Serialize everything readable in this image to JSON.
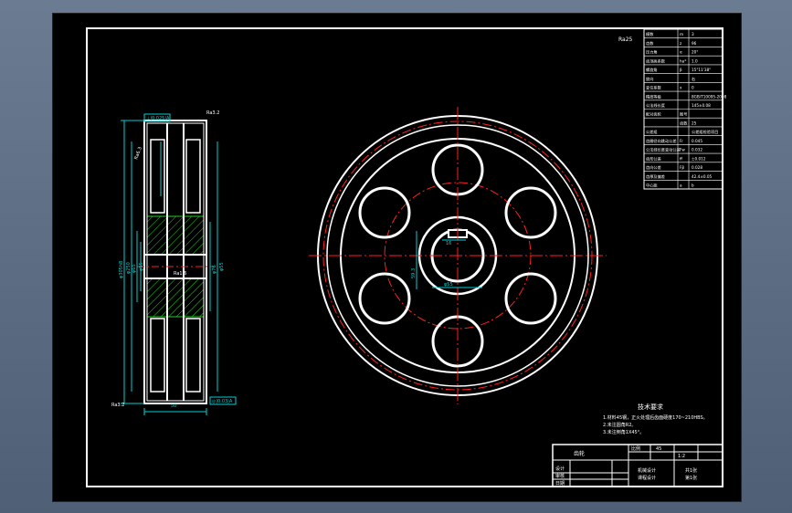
{
  "colors": {
    "background": "#000000",
    "frame": "#ffffff",
    "dimension": "#00d0d0",
    "centerline": "#ff2020",
    "hatch": "#1ed21e",
    "annotation": "#ffffff"
  },
  "side_view": {
    "callouts": [
      "Ra3.2",
      "Ra6.3",
      "Ra1.6",
      "Ra3.2"
    ],
    "datum_box": "⊥|0.025|A",
    "datum_box_bottom": "◎|0.03|A",
    "dims_left": [
      "φ305h8",
      "φ250",
      "φ65",
      "φ55"
    ],
    "dims_right": [
      "φ76",
      "φ55"
    ],
    "width_dim": "50"
  },
  "front_view": {
    "keyway_dim": "16",
    "hub_dim": "59.3",
    "bore_dim": "φ55"
  },
  "roughness_corner": "Ra25",
  "param_table": {
    "rows": [
      [
        "模数",
        "m",
        "3"
      ],
      [
        "齿数",
        "z",
        "96"
      ],
      [
        "压力角",
        "α",
        "20°"
      ],
      [
        "齿顶高系数",
        "ha*",
        "1.0"
      ],
      [
        "螺旋角",
        "β",
        "15°11'38\""
      ],
      [
        "旋向",
        "",
        "右"
      ],
      [
        "变位系数",
        "x",
        "0"
      ],
      [
        "精度等级",
        "",
        "8GB/T10095-2008"
      ],
      [
        "公法线长度",
        "",
        "145±0.08"
      ],
      [
        "配对齿轮",
        "图号",
        ""
      ],
      [
        "",
        "齿数",
        "25"
      ],
      [
        "公差组",
        "",
        "公差组检验项目"
      ],
      [
        "齿圈径向跳动公差",
        "Fr",
        "0.045"
      ],
      [
        "公法线长度变动公差",
        "Fw",
        "0.032"
      ],
      [
        "齿形公差",
        "ff",
        "±0.012"
      ],
      [
        "齿向公差",
        "Fβ",
        "0.028"
      ],
      [
        "齿厚及偏差",
        "",
        "42.4±0.05"
      ],
      [
        "中心距",
        "a",
        "b"
      ]
    ]
  },
  "tech_requirements": {
    "title": "技术要求",
    "items": [
      "1.材料45钢，正火处理后齿面硬度170~210HBS。",
      "2.未注圆角R2。",
      "3.未注倒角1X45°。"
    ]
  },
  "title_block": {
    "name": "齿轮",
    "scale_label": "比例",
    "material": "45",
    "drawing_no": "1:2",
    "designer": "设计",
    "checker": "审核",
    "school": "机械设计",
    "course": "课程设计",
    "sheet": "共1张",
    "sheet_of": "第1张",
    "row_labels": [
      "设计",
      "审核",
      "日期"
    ]
  }
}
